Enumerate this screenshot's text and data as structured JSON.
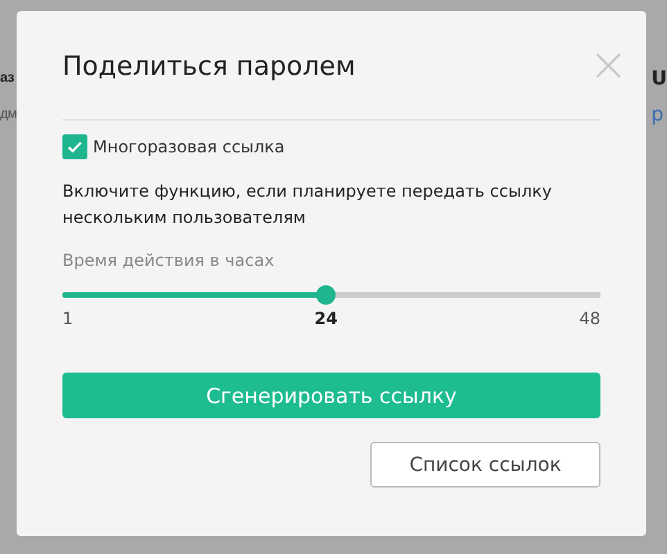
{
  "background": {
    "left_texts": [
      "аз",
      "дм"
    ],
    "right_texts": [
      "U",
      "р"
    ]
  },
  "dialog": {
    "title": "Поделиться паролем",
    "close": "×",
    "reusable": {
      "label": "Многоразовая ссылка",
      "checked": true
    },
    "description": "Включите функцию, если планируете передать ссылку нескольким пользователям",
    "slider": {
      "label": "Время действия в часах",
      "level": 0.49,
      "min": "1",
      "current": "24",
      "max": "48"
    },
    "generate_button": "Сгенерировать ссылку",
    "list_button": "Список ссылок"
  }
}
